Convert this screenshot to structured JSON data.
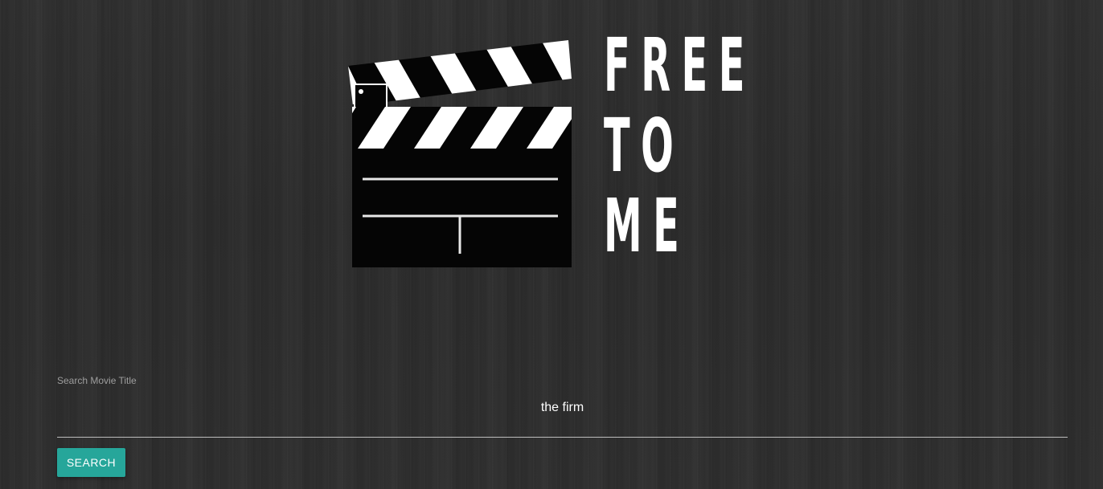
{
  "logo": {
    "lines": [
      "FREE",
      "TO",
      "ME"
    ]
  },
  "icons": {
    "logo": "clapperboard-icon"
  },
  "search": {
    "label": "Search Movie Title",
    "value": "the firm",
    "button_label": "SEARCH"
  },
  "colors": {
    "background": "#2e2e2e",
    "accent": "#26a69a",
    "text": "#ffffff",
    "label": "#9e9e9e"
  }
}
